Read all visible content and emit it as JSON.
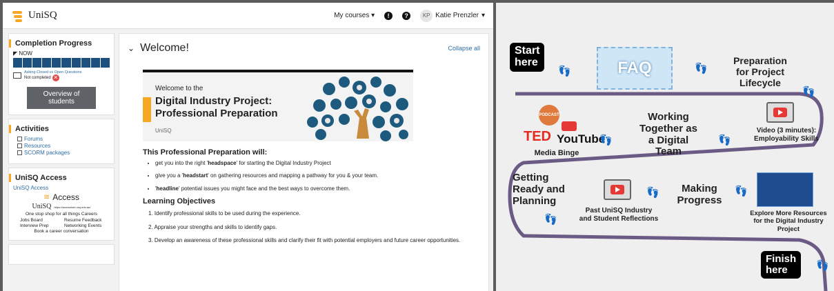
{
  "lms": {
    "logo": "UniSQ",
    "nav": {
      "my_courses": "My courses",
      "user_initials": "KP",
      "user_name": "Katie Prenzler",
      "chevron": "▾"
    },
    "completion": {
      "title": "Completion Progress",
      "now_label": "NOW",
      "segments": 10,
      "assignment_link": "Asking Closed vs Open Questions",
      "status": "Not completed",
      "button": "Overview of students"
    },
    "activities": {
      "title": "Activities",
      "items": [
        "Forums",
        "Resources",
        "SCORM packages"
      ]
    },
    "access": {
      "title": "UniSQ Access",
      "link": "UniSQ Access",
      "card_brand": "UniSQ",
      "card_word": "Access",
      "card_url": "https://accesshub.usq.edu.au/",
      "card_tagline": "One stop shop for all things Careers",
      "card_items": [
        "Jobs Board",
        "Resume Feedback",
        "Interview Prep",
        "Networking Events"
      ],
      "card_footer": "Book a career conversation"
    },
    "main": {
      "heading": "Welcome!",
      "collapse": "Collapse all",
      "banner_line1": "Welcome to the",
      "banner_line2": "Digital Industry Project:",
      "banner_line3": "Professional Preparation",
      "banner_brand": "UniSQ",
      "section_title": "This Professional Preparation will:",
      "bullets": [
        {
          "pre": "get you into the right '",
          "bold": "headspace",
          "post": "' for starting the Digital Industry Project"
        },
        {
          "pre": "give you a '",
          "bold": "headstart",
          "post": "' on gathering resources and mapping a pathway for you & your team."
        },
        {
          "pre": "'",
          "bold": "headline",
          "post": "' potential issues you might face and the best ways to overcome them."
        }
      ],
      "objectives_title": "Learning Objectives",
      "objectives": [
        "1. Identify professional skills to be used during the experience.",
        "2. Appraise your strengths and skills to identify gaps.",
        "3. Develop an awareness of these professional skills and clarify their fit with potential employers and future career opportunities."
      ]
    },
    "colors": {
      "accent": "#f7a823",
      "progress": "#1d4f7f",
      "link": "#2e6da4"
    }
  },
  "roadmap": {
    "start": "Start\nhere",
    "faq": "FAQ",
    "prep": "Preparation\nfor Project\nLifecycle",
    "ted": "TED",
    "youtube": "YouTube",
    "podcast": "PODCAST",
    "media_binge": "Media Binge",
    "working": "Working\nTogether as\na Digital\nTeam",
    "video": "Video (3 minutes):\nEmployability Skills",
    "getting": "Getting\nReady and\nPlanning",
    "past": "Past UniSQ Industry\nand Student Reflections",
    "making": "Making\nProgress",
    "explore": "Explore More Resources\nfor the Digital Industry\nProject",
    "finish": "Finish\nhere",
    "path_color": "#6a5a84"
  }
}
